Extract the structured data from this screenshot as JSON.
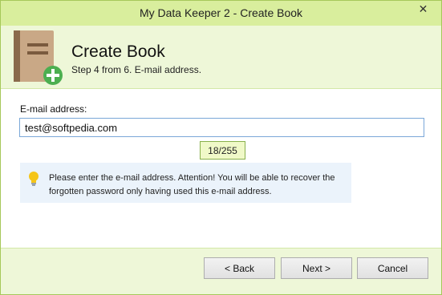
{
  "window": {
    "title": "My Data Keeper 2 - Create Book",
    "close_glyph": "✕"
  },
  "header": {
    "title": "Create Book",
    "subtitle": "Step 4 from 6. E-mail address.",
    "icon": "book-add-icon"
  },
  "form": {
    "email_label": "E-mail address:",
    "email_value": "test@softpedia.com",
    "char_counter": "18/255"
  },
  "hint": {
    "icon": "lightbulb-icon",
    "text": "Please enter the e-mail address. Attention! You will be able to recover the forgotten password only having used this e-mail address."
  },
  "buttons": {
    "back": "< Back",
    "next": "Next >",
    "cancel": "Cancel"
  },
  "colors": {
    "titlebar": "#d9ee9d",
    "panel": "#eef7d8",
    "accent_green": "#5ab65a",
    "hint_bg": "#ebf3fb"
  }
}
